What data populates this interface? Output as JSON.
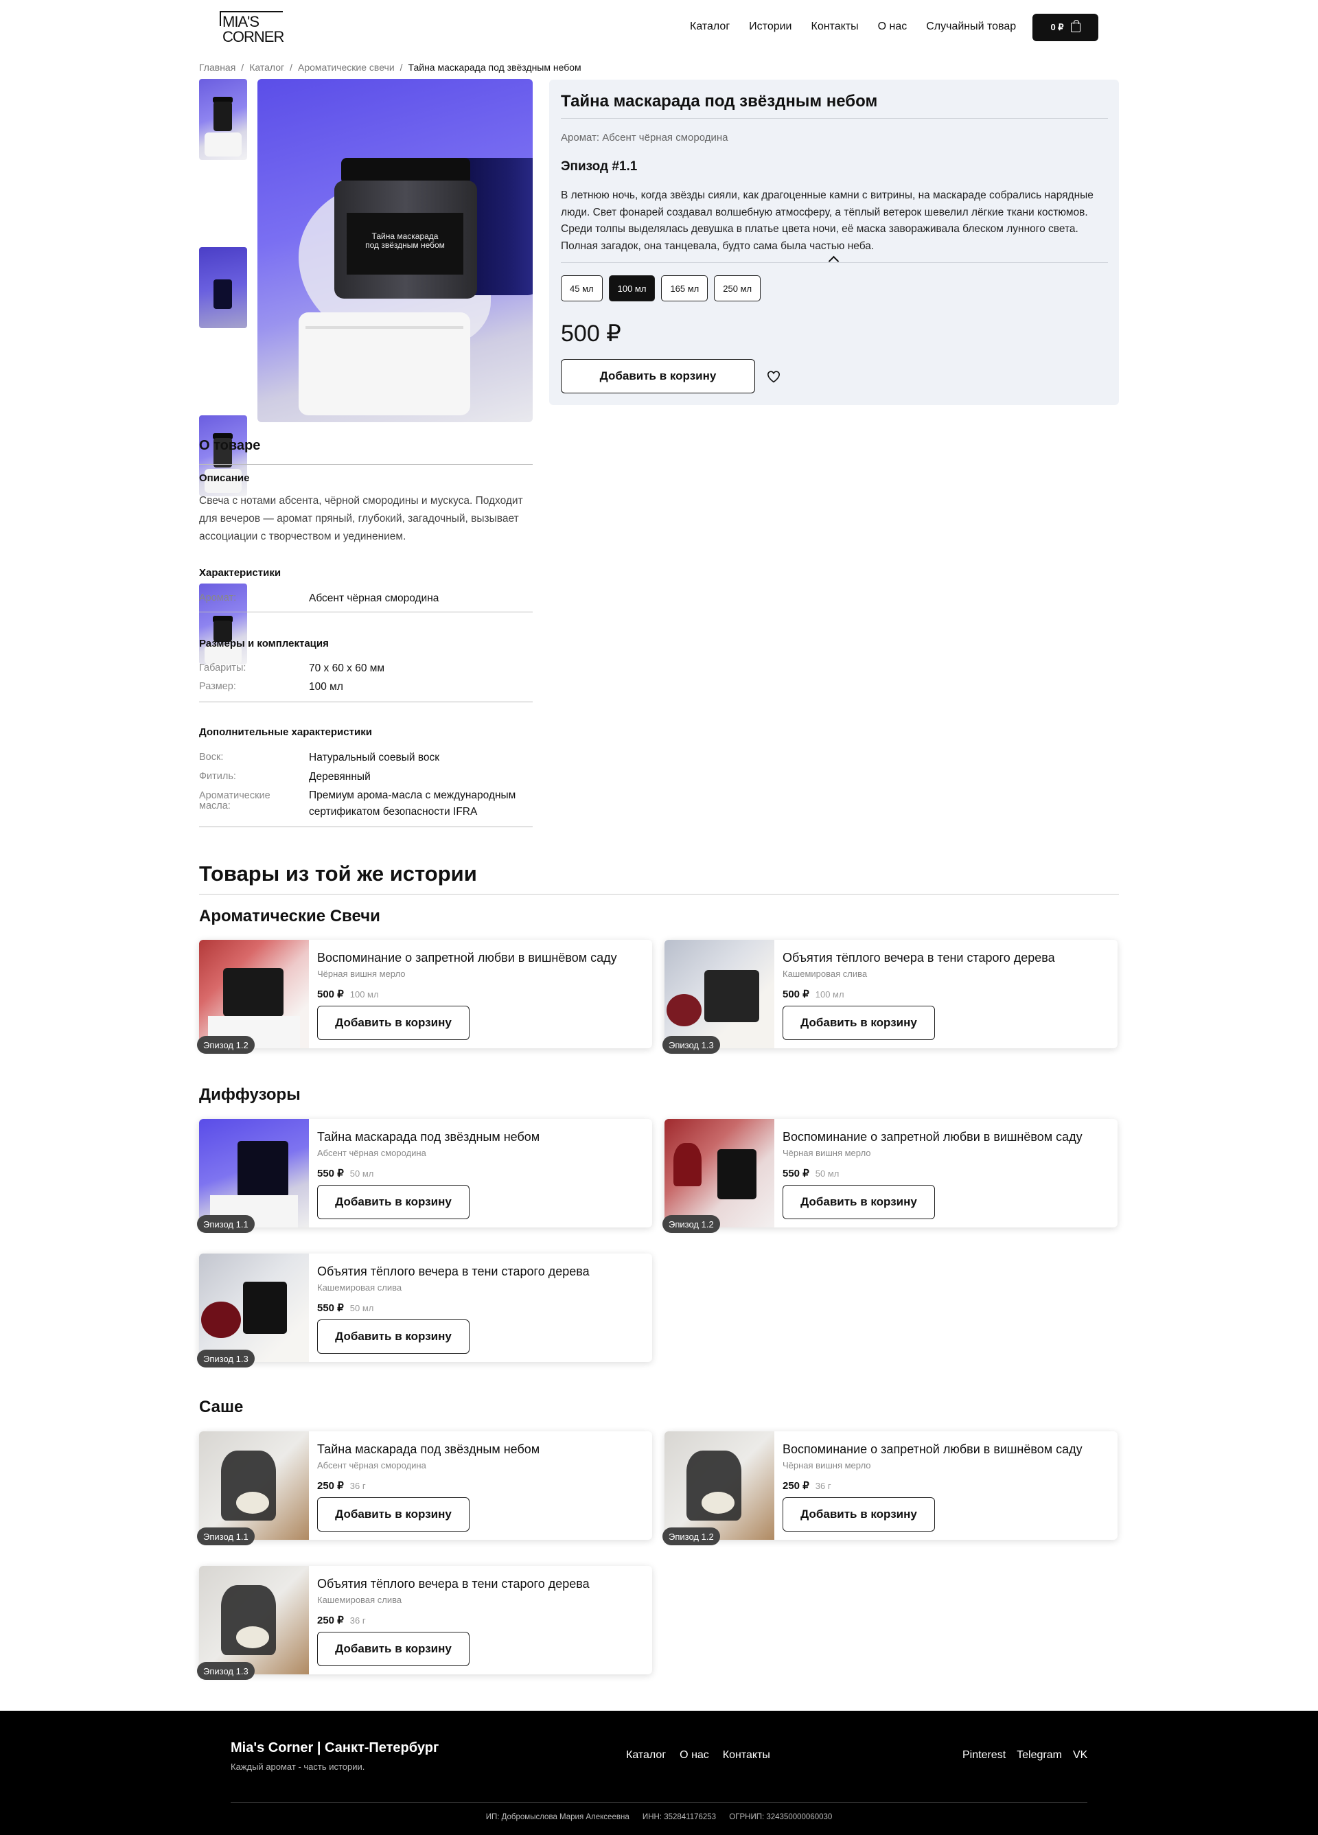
{
  "header": {
    "logo_line1": "MIA'S",
    "logo_line2": "CORNER",
    "nav": [
      "Каталог",
      "Истории",
      "Контакты",
      "О нас",
      "Случайный товар"
    ],
    "cart_total": "0 ₽"
  },
  "breadcrumb": [
    "Главная",
    "Каталог",
    "Ароматические свечи",
    "Тайна маскарада под звёздным небом"
  ],
  "gallery": {
    "photo_label": "Тайна маскарада\nпод звёздным небом"
  },
  "product": {
    "title": "Тайна маскарада под звёздным небом",
    "aroma": "Аромат: Абсент чёрная смородина",
    "episode": "Эпизод #1.1",
    "story": "В летнюю ночь, когда звёзды сияли, как драгоценные камни с витрины, на маскараде собрались нарядные люди. Свет фонарей создавал волшебную атмосферу, а тёплый ветерок шевелил лёгкие ткани костюмов. Среди толпы выделялась девушка в платье цвета ночи, её маска завораживала блеском лунного света. Полная загадок, она танцевала, будто сама была частью неба.",
    "sizes": [
      "45 мл",
      "100 мл",
      "165 мл",
      "250 мл"
    ],
    "selected_size": "100 мл",
    "price": "500 ₽",
    "add_to_cart": "Добавить в корзину"
  },
  "about": {
    "title": "О товаре",
    "description_title": "Описание",
    "description": "Свеча с нотами абсента, чёрной смородины и мускуса. Подходит для вечеров — аромат пряный, глубокий, загадочный, вызывает ассоциации с творчеством и уединением.",
    "characteristics_title": "Характеристики",
    "characteristics": [
      {
        "k": "Аромат:",
        "v": "Абсент чёрная смородина"
      }
    ],
    "sizes_title": "Размеры и комплектация",
    "sizes": [
      {
        "k": "Габариты:",
        "v": "70 x 60 x 60 мм"
      },
      {
        "k": "Размер:",
        "v": "100 мл"
      }
    ],
    "extra_title": "Дополнительные характеристики",
    "extra": [
      {
        "k": "Воск:",
        "v": "Натуральный соевый воск"
      },
      {
        "k": "Фитиль:",
        "v": "Деревянный"
      },
      {
        "k": "Ароматические масла:",
        "v": "Премиум арома-масла с международным сертификатом безопасности IFRA"
      }
    ]
  },
  "related": {
    "title": "Товары из той же истории",
    "categories": [
      {
        "title": "Ароматические Свечи",
        "items": [
          {
            "name": "Воспоминание о запретной любви в вишнёвом саду",
            "aroma": "Чёрная вишня мерло",
            "price": "500 ₽",
            "volume": "100 мл",
            "episode": "Эпизод 1.2",
            "image": "candle-cherry"
          },
          {
            "name": "Объятия тёплого вечера в тени старого дерева",
            "aroma": "Кашемировая слива",
            "price": "500 ₽",
            "volume": "100 мл",
            "episode": "Эпизод 1.3",
            "image": "candle-cream"
          }
        ]
      },
      {
        "title": "Диффузоры",
        "items": [
          {
            "name": "Тайна маскарада под звёздным небом",
            "aroma": "Абсент чёрная смородина",
            "price": "550 ₽",
            "volume": "50 мл",
            "episode": "Эпизод 1.1",
            "image": "diffuser-blue"
          },
          {
            "name": "Воспоминание о запретной любви в вишнёвом саду",
            "aroma": "Чёрная вишня мерло",
            "price": "550 ₽",
            "volume": "50 мл",
            "episode": "Эпизод 1.2",
            "image": "diffuser-red"
          },
          {
            "name": "Объятия тёплого вечера в тени старого дерева",
            "aroma": "Кашемировая слива",
            "price": "550 ₽",
            "volume": "50 мл",
            "episode": "Эпизод 1.3",
            "image": "diffuser-cream"
          }
        ]
      },
      {
        "title": "Саше",
        "items": [
          {
            "name": "Тайна маскарада под звёздным небом",
            "aroma": "Абсент чёрная смородина",
            "price": "250 ₽",
            "volume": "36 г",
            "episode": "Эпизод 1.1",
            "image": "sachet"
          },
          {
            "name": "Воспоминание о запретной любви в вишнёвом саду",
            "aroma": "Чёрная вишня мерло",
            "price": "250 ₽",
            "volume": "36 г",
            "episode": "Эпизод 1.2",
            "image": "sachet"
          },
          {
            "name": "Объятия тёплого вечера в тени старого дерева",
            "aroma": "Кашемировая слива",
            "price": "250 ₽",
            "volume": "36 г",
            "episode": "Эпизод 1.3",
            "image": "sachet"
          }
        ]
      }
    ],
    "button_label": "Добавить в корзину"
  },
  "footer": {
    "brand": "Mia's Corner | Санкт-Петербург",
    "tagline": "Каждый аромат - часть истории.",
    "nav": [
      "Каталог",
      "О нас",
      "Контакты"
    ],
    "social": [
      "Pinterest",
      "Telegram",
      "VK"
    ],
    "legal": [
      "ИП: Добромыслова Мария Алексеевна",
      "ИНН: 352841176253",
      "ОГРНИП: 324350000060030"
    ]
  },
  "colors": {
    "primary": "#111111",
    "panel_bg": "#eff2f7",
    "badge_bg": "#444444",
    "footer_bg": "#000000"
  }
}
